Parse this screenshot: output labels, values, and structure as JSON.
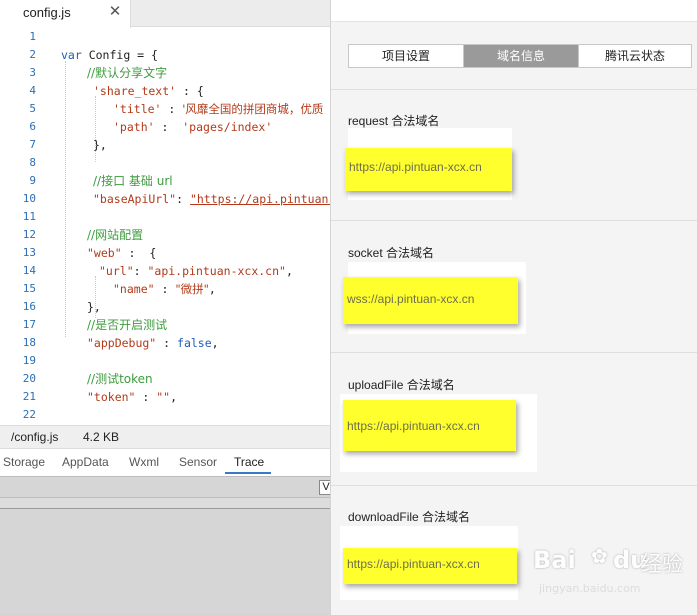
{
  "editor": {
    "tab": {
      "label": "config.js",
      "close_glyph": "✕"
    },
    "line_numbers": [
      "1",
      "2",
      "3",
      "4",
      "5",
      "6",
      "7",
      "8",
      "9",
      "10",
      "11",
      "12",
      "13",
      "14",
      "15",
      "16",
      "17",
      "18",
      "19",
      "20",
      "21",
      "22"
    ],
    "lines": {
      "l2_kw": "var",
      "l2_rest": " Config = {",
      "l3": "//默认分享文字",
      "l4_key": "'share_text'",
      "l4_rest": " : {",
      "l5_key": "'title'",
      "l5_sep": " : ",
      "l5_val": "'风靡全国的拼团商城，优质",
      "l6_key": "'path'",
      "l6_sep": " :  ",
      "l6_val": "'pages/index'",
      "l7": "},",
      "l9": "//接口 基础 url",
      "l10_key": "\"baseApiUrl\"",
      "l10_sep": ": ",
      "l10_val": "\"https://api.pintuan-x",
      "l12": "//网站配置",
      "l13_key": "\"web\"",
      "l13_rest": " :  {",
      "l14_key": "\"url\"",
      "l14_sep": ": ",
      "l14_val": "\"api.pintuan-xcx.cn\"",
      "l14_end": ",",
      "l15_key": "\"name\"",
      "l15_sep": " : ",
      "l15_val": "\"微拼\"",
      "l15_end": ",",
      "l16": "},",
      "l17": "//是否开启测试",
      "l18_key": "\"appDebug\"",
      "l18_sep": " : ",
      "l18_val": "false",
      "l18_end": ",",
      "l20": "//测试token",
      "l21_key": "\"token\"",
      "l21_sep": " : ",
      "l21_val": "\"\"",
      "l21_end": ","
    },
    "status": {
      "path": "/config.js",
      "size": "4.2 KB"
    },
    "devtools_tabs": [
      "Storage",
      "AppData",
      "Wxml",
      "Sensor",
      "Trace"
    ],
    "devtools_active_tab": "Trace",
    "devtools_button": "V"
  },
  "panel": {
    "tabs": [
      "项目设置",
      "域名信息",
      "腾讯云状态"
    ],
    "active_tab": "域名信息",
    "sections": [
      {
        "title": "request 合法域名",
        "domain": "https://api.pintuan-xcx.cn"
      },
      {
        "title": "socket 合法域名",
        "domain": "wss://api.pintuan-xcx.cn"
      },
      {
        "title": "uploadFile 合法域名",
        "domain": "https://api.pintuan-xcx.cn"
      },
      {
        "title": "downloadFile 合法域名",
        "domain": "https://api.pintuan-xcx.cn"
      }
    ]
  },
  "watermark": {
    "brand": "Bai",
    "brand2": "du",
    "cn": "经验",
    "url": "jingyan.baidu.com"
  },
  "colors": {
    "highlight": "#ffff2e",
    "active_tab": "#9a9a9a",
    "trace_underline": "#3a78c8",
    "line_number": "#2d6fb3",
    "comment": "#3f9b3f",
    "string": "#b33a1a",
    "keyword": "#1d5fb8"
  }
}
